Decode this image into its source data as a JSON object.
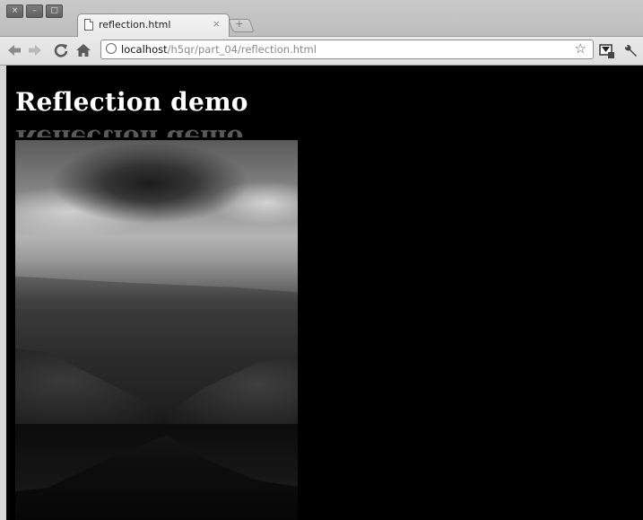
{
  "window": {
    "close_glyph": "×",
    "minimize_glyph": "–",
    "maximize_glyph": "□"
  },
  "tabs": [
    {
      "label": "reflection.html",
      "close_glyph": "×",
      "icon": "page-icon"
    }
  ],
  "new_tab_glyph": "+",
  "toolbar": {
    "back_icon": "back-arrow-icon",
    "forward_icon": "forward-arrow-icon",
    "reload_icon": "reload-icon",
    "home_icon": "home-icon",
    "url_host": "localhost",
    "url_path": "/h5qr/part_04/reflection.html",
    "star_glyph": "☆",
    "wrench_glyph": "🔧"
  },
  "page": {
    "heading": "Reflection demo",
    "background_color": "#000000",
    "image_alt": "landscape-photo"
  }
}
